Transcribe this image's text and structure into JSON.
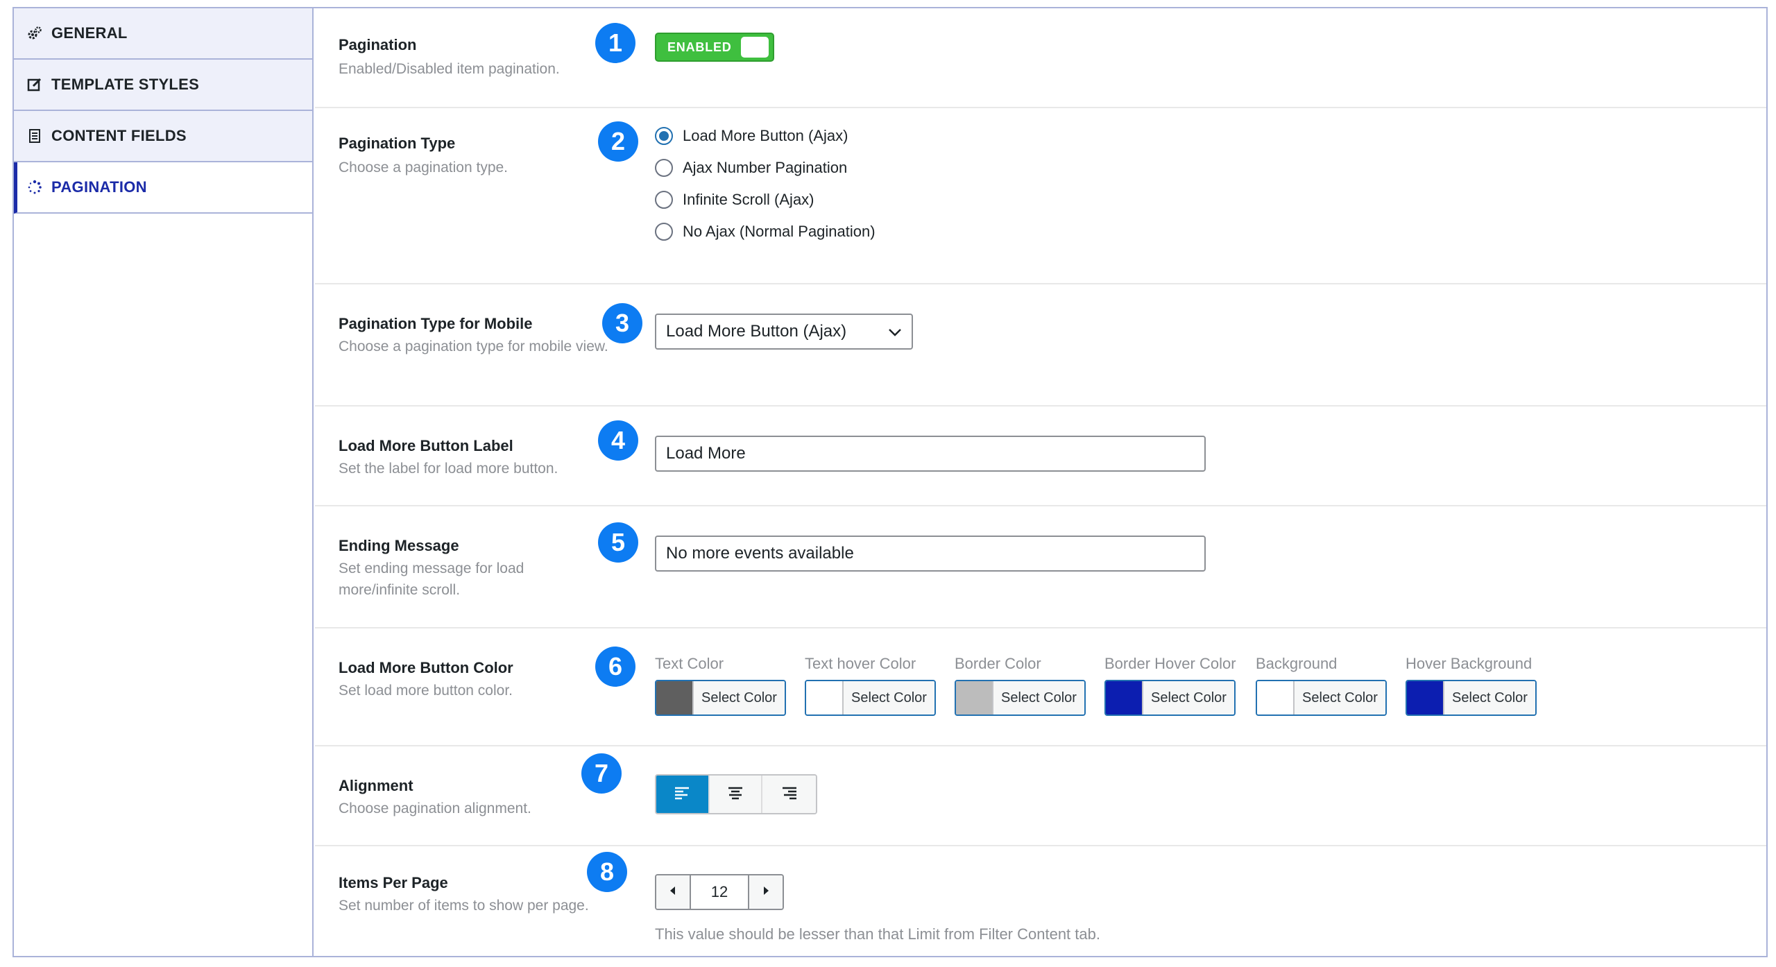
{
  "sidebar": {
    "tabs": [
      {
        "label": "GENERAL",
        "icon": "gears-icon"
      },
      {
        "label": "TEMPLATE STYLES",
        "icon": "edit-icon"
      },
      {
        "label": "CONTENT FIELDS",
        "icon": "document-icon"
      },
      {
        "label": "PAGINATION",
        "icon": "spinner-icon",
        "active": true
      }
    ]
  },
  "settings": {
    "pagination": {
      "label": "Pagination",
      "desc": "Enabled/Disabled item pagination.",
      "badge": "1",
      "toggle_label": "ENABLED"
    },
    "pagination_type": {
      "label": "Pagination Type",
      "desc": "Choose a pagination type.",
      "badge": "2",
      "options": [
        "Load More Button (Ajax)",
        "Ajax Number Pagination",
        "Infinite Scroll (Ajax)",
        "No Ajax (Normal Pagination)"
      ],
      "selected_index": 0
    },
    "mobile_type": {
      "label": "Pagination Type for Mobile",
      "desc": "Choose a pagination type for mobile view.",
      "badge": "3",
      "value": "Load More Button (Ajax)"
    },
    "button_label": {
      "label": "Load More Button Label",
      "desc": "Set the label for load more button.",
      "badge": "4",
      "value": "Load More"
    },
    "ending_message": {
      "label": "Ending Message",
      "desc": "Set ending message for load more/infinite scroll.",
      "badge": "5",
      "value": "No more events available"
    },
    "button_color": {
      "label": "Load More Button Color",
      "desc": "Set load more button color.",
      "badge": "6",
      "button_text": "Select Color",
      "colors": [
        {
          "label": "Text Color",
          "swatch": "#5f5f5f"
        },
        {
          "label": "Text hover Color",
          "swatch": "#ffffff"
        },
        {
          "label": "Border Color",
          "swatch": "#bcbcbc"
        },
        {
          "label": "Border Hover Color",
          "swatch": "#0c1eb0"
        },
        {
          "label": "Background",
          "swatch": "#ffffff"
        },
        {
          "label": "Hover Background",
          "swatch": "#0c1eb0"
        }
      ]
    },
    "alignment": {
      "label": "Alignment",
      "desc": "Choose pagination alignment.",
      "badge": "7",
      "options": [
        "left",
        "center",
        "right"
      ],
      "selected": "left"
    },
    "items_per_page": {
      "label": "Items Per Page",
      "desc": "Set number of items to show per page.",
      "badge": "8",
      "value": "12",
      "hint": "This value should be lesser than that Limit from Filter Content tab."
    }
  },
  "colors": {
    "accent": "#0d7cf2",
    "toggle_on": "#3fbf3f",
    "active_tab": "#1b2ba8",
    "align_active": "#0a87c8"
  }
}
